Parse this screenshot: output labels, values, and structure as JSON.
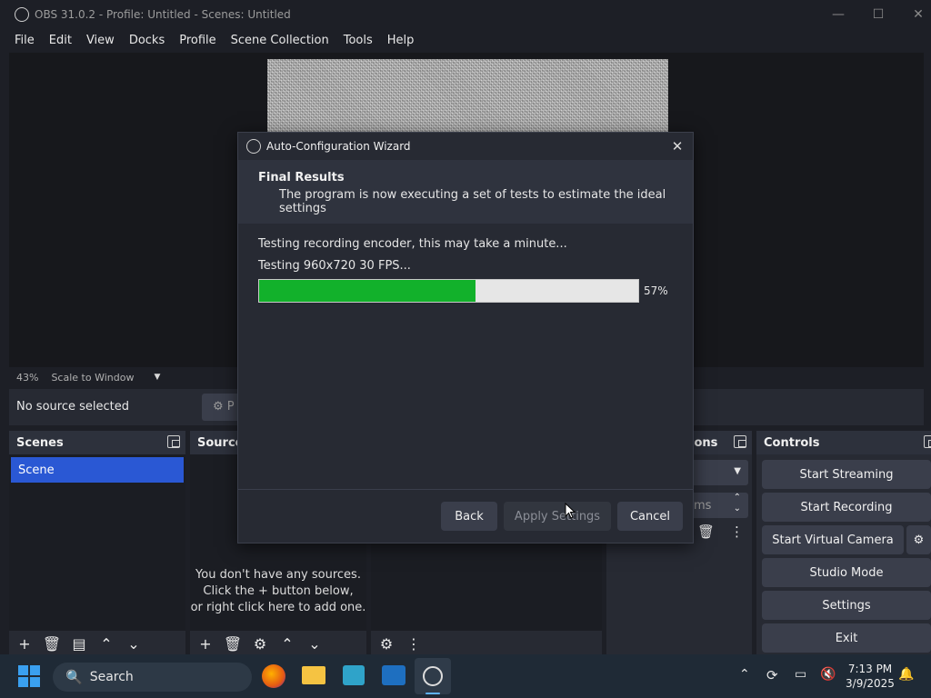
{
  "window": {
    "title": "OBS 31.0.2 - Profile: Untitled - Scenes: Untitled",
    "minimize": "—",
    "maximize": "☐",
    "close": "✕"
  },
  "menu": [
    "File",
    "Edit",
    "View",
    "Docks",
    "Profile",
    "Scene Collection",
    "Tools",
    "Help"
  ],
  "preview": {
    "zoom": "43%",
    "scale_mode": "Scale to Window"
  },
  "source_toolbar": {
    "no_source": "No source selected",
    "properties_partial": "P"
  },
  "docks": {
    "scenes": {
      "title": "Scenes",
      "items": [
        "Scene"
      ]
    },
    "sources": {
      "title": "Source",
      "empty_lines": [
        "You don't have any sources.",
        "Click the + button below,",
        "or right click here to add one."
      ]
    },
    "transitions": {
      "title_partial": "ions",
      "duration_partial": "ms"
    },
    "controls": {
      "title": "Controls",
      "buttons": [
        "Start Streaming",
        "Start Recording",
        "Start Virtual Camera",
        "Studio Mode",
        "Settings",
        "Exit"
      ]
    }
  },
  "dialog": {
    "title": "Auto-Configuration Wizard",
    "header_title": "Final Results",
    "header_subtitle": "The program is now executing a set of tests to estimate the ideal settings",
    "status_line": "Testing recording encoder, this may take a minute...",
    "test_line": "Testing 960x720 30 FPS...",
    "progress": 0.57,
    "progress_label": "57%",
    "buttons": {
      "back": "Back",
      "apply": "Apply Settings",
      "cancel": "Cancel"
    },
    "close": "✕"
  },
  "taskbar": {
    "search_label": "Search",
    "time": "7:13 PM",
    "date": "3/9/2025"
  },
  "colors": {
    "accent_blue": "#2a58d4",
    "progress_green": "#12b12b"
  }
}
